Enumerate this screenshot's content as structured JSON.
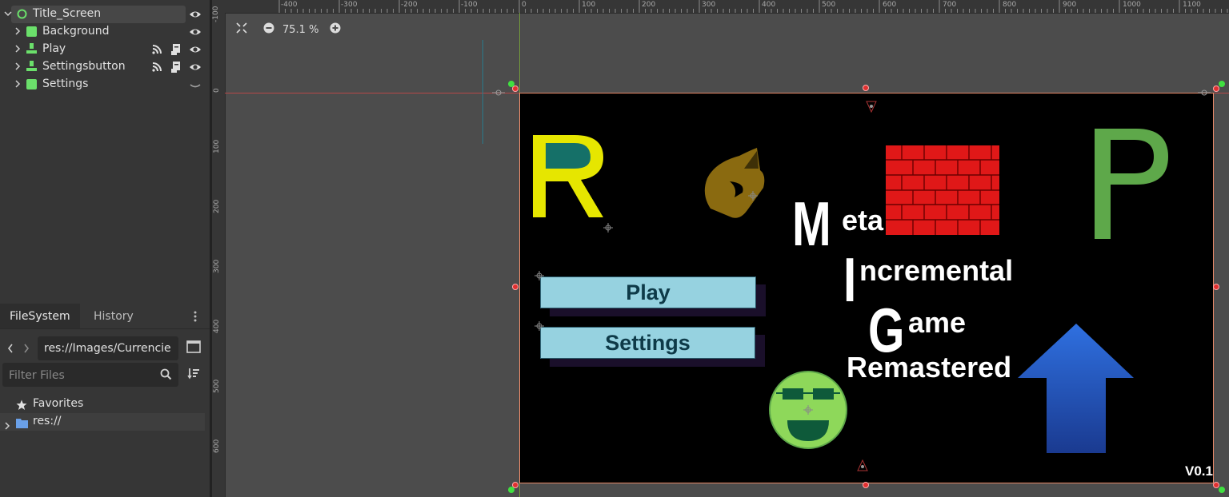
{
  "scene_tree": {
    "nodes": [
      {
        "label": "Title_Screen",
        "type": "control-root",
        "expanded": true,
        "selected": true,
        "icons": [
          "eye-icon"
        ]
      },
      {
        "label": "Background",
        "type": "panel",
        "expanded": false,
        "icons": [
          "eye-icon"
        ]
      },
      {
        "label": "Play",
        "type": "button",
        "expanded": false,
        "icons": [
          "signal-icon",
          "script-icon",
          "eye-icon"
        ]
      },
      {
        "label": "Settingsbutton",
        "type": "button",
        "expanded": false,
        "icons": [
          "signal-icon",
          "script-icon",
          "eye-icon"
        ]
      },
      {
        "label": "Settings",
        "type": "panel",
        "expanded": false,
        "icons": [
          "eye-closed-icon"
        ]
      }
    ]
  },
  "filesystem": {
    "tabs": [
      "FileSystem",
      "History"
    ],
    "active_tab": "FileSystem",
    "path": "res://Images/Currencie",
    "filter_placeholder": "Filter Files",
    "favorites_label": "Favorites",
    "root_label": "res://"
  },
  "viewport": {
    "zoom": "75.1 %",
    "ruler_top": [
      "-400",
      "-300",
      "-200",
      "-100",
      "0",
      "100",
      "200",
      "300",
      "400",
      "500",
      "600",
      "700",
      "800",
      "900",
      "1000",
      "1100"
    ],
    "ruler_left": [
      "-100",
      "0",
      "100",
      "200",
      "300",
      "400",
      "500",
      "600"
    ]
  },
  "scene": {
    "letter_r": "R",
    "letter_p": "P",
    "play_label": "Play",
    "settings_label": "Settings",
    "title_lines": [
      {
        "cap": "M",
        "rest": "eta"
      },
      {
        "cap": "I",
        "rest": "ncremental"
      },
      {
        "cap": "G",
        "rest": "ame"
      },
      {
        "cap": "",
        "rest": "Remastered"
      }
    ],
    "version": "V0.1"
  },
  "colors": {
    "accent_green": "#6be06b",
    "selection": "#474747",
    "letter_r": "#e6e600",
    "letter_p": "#5ea84a",
    "button_fill": "#96d2e0",
    "arrow_blue": "#2560c8",
    "brick_red": "#e01818"
  }
}
